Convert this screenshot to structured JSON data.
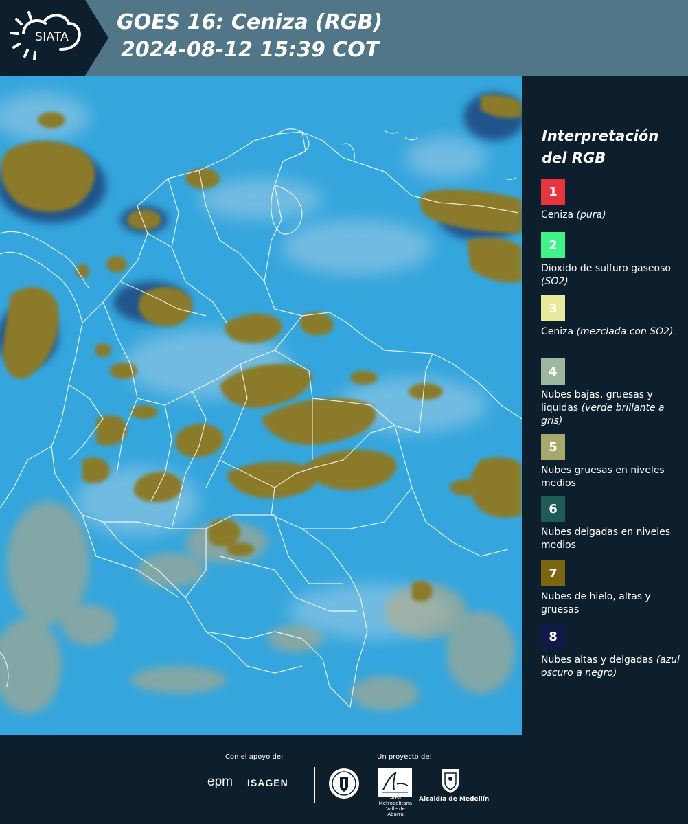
{
  "header": {
    "logo_text": "SIATA",
    "title_line1": "GOES 16: Ceniza (RGB)",
    "title_line2": "2024-08-12 15:39 COT"
  },
  "legend": {
    "title": "Interpretación del RGB",
    "items": [
      {
        "number": "1",
        "color": "#e8343c",
        "label": "Ceniza",
        "note": "(pura)"
      },
      {
        "number": "2",
        "color": "#3ff28a",
        "label": "Dioxido de sulfuro gaseoso",
        "note": "(SO2)"
      },
      {
        "number": "3",
        "color": "#e9e99a",
        "label": "Ceniza",
        "note": "(mezclada con SO2)"
      },
      {
        "number": "4",
        "color": "#9db8a1",
        "label": "Nubes bajas, gruesas y liquidas",
        "note": "(verde brillante a gris)"
      },
      {
        "number": "5",
        "color": "#a6a96a",
        "label": "Nubes gruesas en niveles medios",
        "note": ""
      },
      {
        "number": "6",
        "color": "#1f5b56",
        "label": "Nubes delgadas en niveles medios",
        "note": ""
      },
      {
        "number": "7",
        "color": "#7a6511",
        "label": "Nubes de hielo, altas y gruesas",
        "note": ""
      },
      {
        "number": "8",
        "color": "#101a48",
        "label": "Nubes altas y delgadas",
        "note": "(azul oscuro a negro)"
      }
    ]
  },
  "footer": {
    "support_label": "Con el apoyo de:",
    "project_label": "Un proyecto de:",
    "sponsors": [
      "epm",
      "ISAGEN"
    ],
    "partners": [
      "Área Metropolitana Valle de Aburrá",
      "Alcaldía de Medellín"
    ]
  },
  "colors": {
    "background": "#0d1f2c",
    "header": "#517687",
    "sky": "#35a6dd",
    "thick_cloud": "#8a7a2a"
  }
}
